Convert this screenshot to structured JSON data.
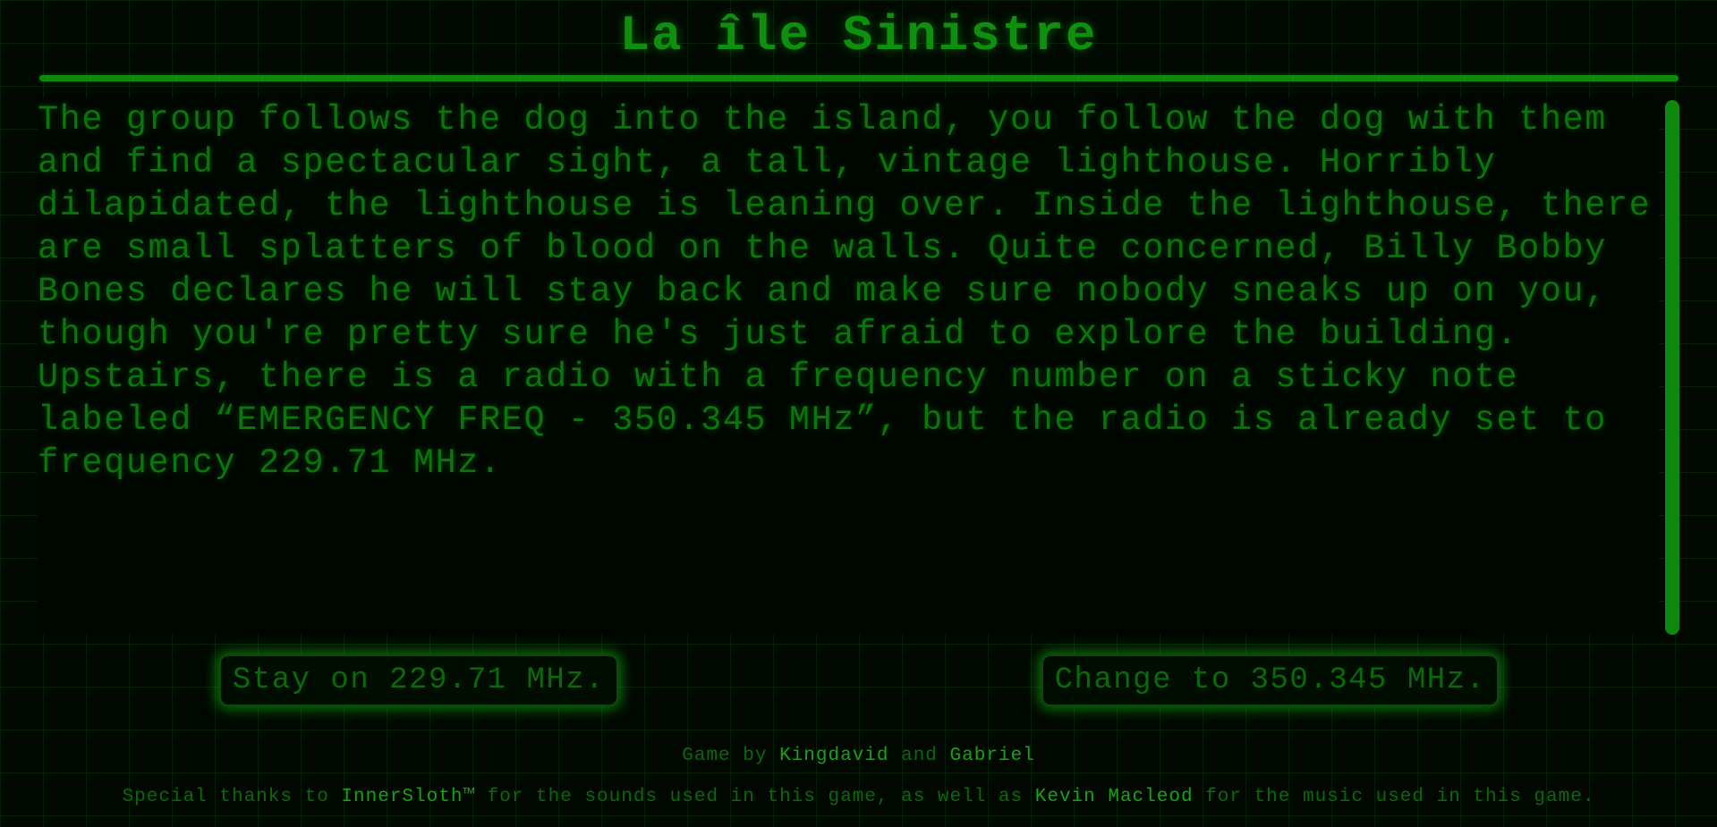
{
  "game": {
    "title": "La île Sinistre"
  },
  "story": {
    "text": "The group follows the dog into the island, you follow the dog with them and find a spectacular sight, a tall, vintage lighthouse. Horribly dilapidated, the lighthouse is leaning over. Inside the lighthouse, there are small splatters of blood on the walls. Quite concerned, Billy Bobby Bones declares he will stay back and make sure nobody sneaks up on you, though you're pretty sure he's just afraid to explore the building. Upstairs, there is a radio with a frequency number on a sticky note labeled “EMERGENCY FREQ - 350.345 MHz”, but the radio is already set to frequency 229.71 MHz."
  },
  "choices": [
    {
      "label": "Stay on 229.71 MHz."
    },
    {
      "label": "Change to 350.345 MHz."
    }
  ],
  "credits": {
    "prefix": "Game by ",
    "author1": "Kingdavid",
    "joiner": " and ",
    "author2": "Gabriel"
  },
  "thanks": {
    "part1": "Special thanks to ",
    "credit1": "InnerSloth™",
    "part2": " for the sounds used in this game, as well as ",
    "credit2": "Kevin Macleod",
    "part3": " for the music used in this game."
  },
  "colors": {
    "background": "#000800",
    "primary_green": "#0e8f0e",
    "text_green": "#0a750a",
    "highlight_green": "#17a317"
  }
}
